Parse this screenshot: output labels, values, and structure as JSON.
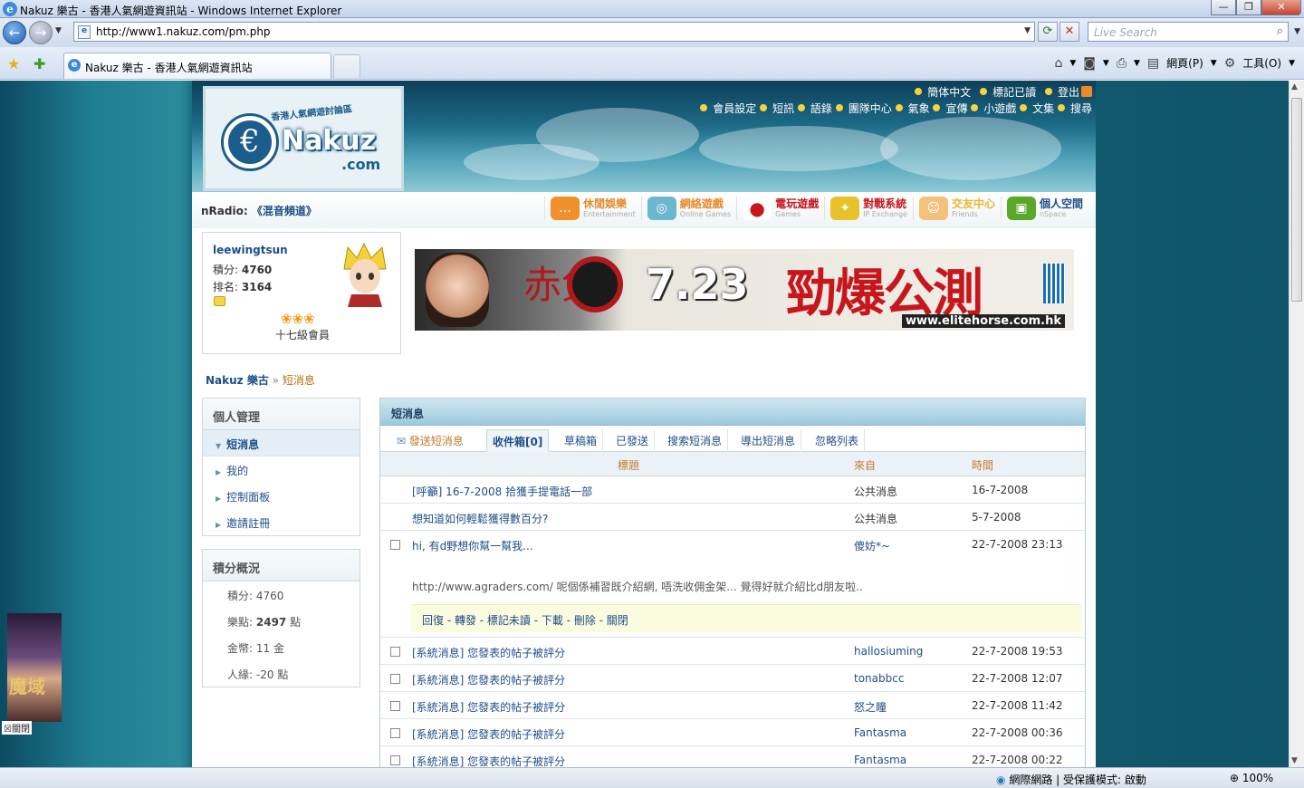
{
  "window": {
    "title": "Nakuz 樂古 - 香港人氣網遊資訊站 - Windows Internet Explorer"
  },
  "browser": {
    "url": "http://www1.nakuz.com/pm.php",
    "search_placeholder": "Live Search",
    "tab_title": "Nakuz 樂古 - 香港人氣網遊資訊站",
    "page_menu": "網頁(P)",
    "tools_menu": "工具(O)",
    "status_zone": "網際網路 | 受保護模式: 啟動",
    "zoom": "100%"
  },
  "site": {
    "logo_word": "Nakuz",
    "logo_com": ".com",
    "logo_tag": "香港人氣網遊討論區",
    "top_links_row1": [
      "簡体中文",
      "標記已讀",
      "登出"
    ],
    "top_links_row2": [
      "會員設定",
      "短訊",
      "語錄",
      "團隊中心",
      "氣象",
      "宣傳",
      "小遊戲",
      "文集",
      "搜尋"
    ],
    "nradio_label": "nRadio:",
    "nradio_channel": "《混音頻道》",
    "categories": [
      {
        "title": "休閒娛樂",
        "sub": "Entertainment",
        "color": "#e8892a"
      },
      {
        "title": "網絡遊戲",
        "sub": "Online Games",
        "color": "#e8892a"
      },
      {
        "title": "電玩遊戲",
        "sub": "Games",
        "color": "#c8161d"
      },
      {
        "title": "對戰系統",
        "sub": "IP Exchange",
        "color": "#c8161d"
      },
      {
        "title": "交友中心",
        "sub": "Friends",
        "color": "#e8b62a"
      },
      {
        "title": "個人空間",
        "sub": "nSpace",
        "color": "#1d4e89"
      }
    ]
  },
  "user": {
    "name": "leewingtsun",
    "points_label": "積分:",
    "points": "4760",
    "rank_label": "排名:",
    "rank": "3164",
    "level": "十七級會員"
  },
  "banner": {
    "date": "7.23",
    "slogan": "勁爆公測",
    "site": "www.elitehorse.com.hk",
    "horse": "赤兔"
  },
  "breadcrumb": {
    "home": "Nakuz 樂古",
    "sep": "»",
    "current": "短消息"
  },
  "sidebar": {
    "manage_title": "個人管理",
    "items": [
      "短消息",
      "我的",
      "控制面板",
      "邀請註冊"
    ],
    "credits_title": "積分概況",
    "credits": [
      {
        "label": "積分:",
        "value": "4760",
        "unit": ""
      },
      {
        "label": "樂點:",
        "value": "2497",
        "unit": "點"
      },
      {
        "label": "金幣:",
        "value": "11",
        "unit": "金"
      },
      {
        "label": "人緣:",
        "value": "-20",
        "unit": "點"
      }
    ]
  },
  "pm": {
    "title": "短消息",
    "tabs": [
      "發送短消息",
      "收件箱[0]",
      "草稿箱",
      "已發送",
      "搜索短消息",
      "導出短消息",
      "忽略列表"
    ],
    "headers": {
      "subject": "標題",
      "from": "來自",
      "time": "時間"
    },
    "rows_top": [
      {
        "subject": "[呼籲] 16-7-2008 拾獲手提電話一部",
        "from": "公共消息",
        "time": "16-7-2008"
      },
      {
        "subject": "想知道如何輕鬆獲得數百分?",
        "from": "公共消息",
        "time": "5-7-2008"
      },
      {
        "subject": "hi, 有d野想你幫一幫我...",
        "from": "傻妨*~",
        "time": "22-7-2008 23:13"
      }
    ],
    "expanded_message": "http://www.agraders.com/ 呢個係補習既介紹網, 唔洗收佣金架... 覺得好就介紹比d朋友啦..",
    "expanded_actions": "回復 - 轉發 - 標記未讀 - 下載 - 刪除 - 關閉",
    "rows_bottom": [
      {
        "subject": "[系統消息] 您發表的帖子被評分",
        "from": "hallosiuming",
        "time": "22-7-2008 19:53"
      },
      {
        "subject": "[系統消息] 您發表的帖子被評分",
        "from": "tonabbcc",
        "time": "22-7-2008 12:07"
      },
      {
        "subject": "[系統消息] 您發表的帖子被評分",
        "from": "怒之瞳",
        "time": "22-7-2008 11:42"
      },
      {
        "subject": "[系統消息] 您發表的帖子被評分",
        "from": "Fantasma",
        "time": "22-7-2008 00:36"
      },
      {
        "subject": "[系統消息] 您發表的帖子被評分",
        "from": "Fantasma",
        "time": "22-7-2008 00:22"
      }
    ]
  },
  "side_ad": {
    "text": "魔域",
    "close": "關閉"
  }
}
